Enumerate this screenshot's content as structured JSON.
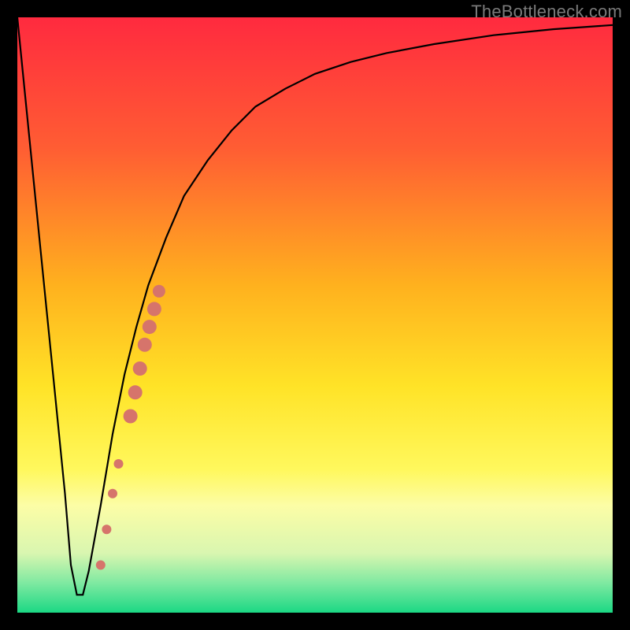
{
  "watermark": "TheBottleneck.com",
  "chart_data": {
    "type": "line",
    "title": "",
    "xlabel": "",
    "ylabel": "",
    "xlim": [
      0,
      100
    ],
    "ylim": [
      0,
      100
    ],
    "grid": false,
    "legend": false,
    "background_gradient": {
      "stops": [
        {
          "pos": 0.0,
          "color": "#ff2a3f"
        },
        {
          "pos": 0.22,
          "color": "#ff5d33"
        },
        {
          "pos": 0.45,
          "color": "#ffb11e"
        },
        {
          "pos": 0.62,
          "color": "#ffe327"
        },
        {
          "pos": 0.76,
          "color": "#fff85d"
        },
        {
          "pos": 0.82,
          "color": "#fcfda6"
        },
        {
          "pos": 0.9,
          "color": "#d9f6b0"
        },
        {
          "pos": 0.95,
          "color": "#7fe9a1"
        },
        {
          "pos": 1.0,
          "color": "#1bd884"
        }
      ]
    },
    "series": [
      {
        "name": "bottleneck-curve",
        "color": "#000000",
        "x": [
          0,
          2,
          4,
          6,
          8,
          9,
          10,
          11,
          12,
          14,
          16,
          18,
          20,
          22,
          25,
          28,
          32,
          36,
          40,
          45,
          50,
          56,
          62,
          70,
          80,
          90,
          100
        ],
        "y": [
          100,
          80,
          60,
          40,
          20,
          8,
          3,
          3,
          7,
          18,
          30,
          40,
          48,
          55,
          63,
          70,
          76,
          81,
          85,
          88,
          90.5,
          92.5,
          94,
          95.5,
          97,
          98,
          98.7
        ]
      }
    ],
    "highlight_band": {
      "name": "highlighted-segment",
      "color": "#d6746b",
      "points": [
        {
          "x": 14.0,
          "y": 8,
          "r": 6
        },
        {
          "x": 15.0,
          "y": 14,
          "r": 6
        },
        {
          "x": 16.0,
          "y": 20,
          "r": 6
        },
        {
          "x": 17.0,
          "y": 25,
          "r": 6
        },
        {
          "x": 19.0,
          "y": 33,
          "r": 9
        },
        {
          "x": 19.8,
          "y": 37,
          "r": 9
        },
        {
          "x": 20.6,
          "y": 41,
          "r": 9
        },
        {
          "x": 21.4,
          "y": 45,
          "r": 9
        },
        {
          "x": 22.2,
          "y": 48,
          "r": 9
        },
        {
          "x": 23.0,
          "y": 51,
          "r": 9
        },
        {
          "x": 23.8,
          "y": 54,
          "r": 8
        }
      ]
    }
  }
}
